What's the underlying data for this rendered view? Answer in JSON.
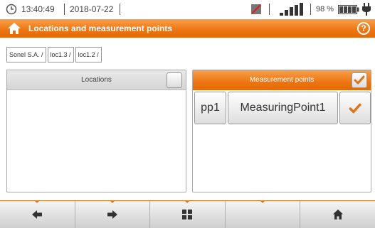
{
  "status": {
    "time": "13:40:49",
    "date": "2018-07-22",
    "battery_percent": "98 %"
  },
  "title_bar": {
    "title": "Locations and measurement points"
  },
  "breadcrumb": [
    "Sonel S.A. /",
    "loc1.3 /",
    "loc1.2 /"
  ],
  "locations_panel": {
    "header": "Locations",
    "checked": false
  },
  "measurement_panel": {
    "header": "Measurement points",
    "checked": true,
    "points": [
      {
        "id": "pp1",
        "name": "MeasuringPoint1",
        "checked": true
      }
    ]
  },
  "toolbar": {
    "buttons": [
      "arrow-left-icon",
      "arrow-right-icon",
      "grid-icon",
      "",
      "home-icon"
    ]
  },
  "colors": {
    "accent": "#ee7410",
    "check": "#e8700e"
  }
}
